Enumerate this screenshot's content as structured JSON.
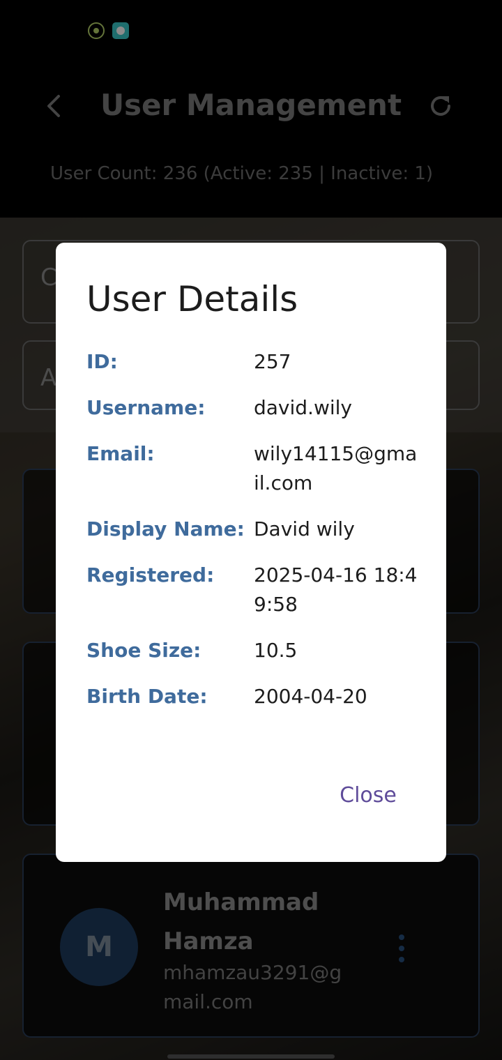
{
  "header": {
    "title": "User Management",
    "user_count": "User Count: 236 (Active: 235 | Inactive: 1)"
  },
  "filters": {
    "search_partial": "C",
    "select_partial": "A"
  },
  "cards": [
    {
      "avatar_letter": "M",
      "name": "Muhammad Hamza",
      "email": "mhamzau3291@gmail.com"
    }
  ],
  "dialog": {
    "title": "User Details",
    "rows": [
      {
        "label": "ID:",
        "value": "257"
      },
      {
        "label": "Username:",
        "value": "david.wily"
      },
      {
        "label": "Email:",
        "value": "wily14115@gmail.com"
      },
      {
        "label": "Display Name:",
        "value": "David wily"
      },
      {
        "label": "Registered:",
        "value": "2025-04-16 18:49:58"
      },
      {
        "label": "Shoe Size:",
        "value": "10.5"
      },
      {
        "label": "Birth Date:",
        "value": "2004-04-20"
      }
    ],
    "close_label": "Close"
  },
  "colors": {
    "label_blue": "#3f6b9c",
    "close_purple": "#5f4c9a",
    "avatar_bg": "#1e3b5e"
  },
  "icons": {
    "back": "back-arrow-icon",
    "refresh": "refresh-icon",
    "menu": "more-vertical-icon"
  }
}
